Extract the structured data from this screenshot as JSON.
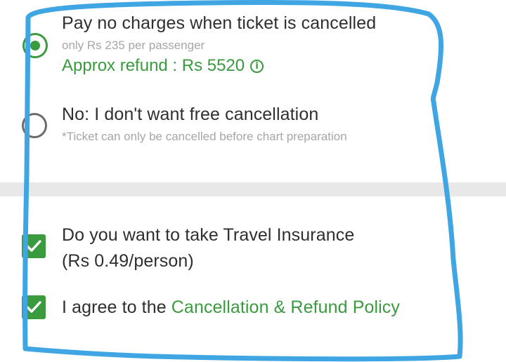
{
  "options": {
    "free_cancel": {
      "title": "Pay no charges when ticket is cancelled",
      "price_note": "only Rs 235 per passenger",
      "refund_text": "Approx refund : Rs 5520",
      "info_glyph": "i",
      "selected": true
    },
    "no_cancel": {
      "title": "No: I don't want free cancellation",
      "note": "*Ticket can only be cancelled before chart preparation",
      "selected": false
    }
  },
  "insurance": {
    "line1": "Do you want to take Travel Insurance",
    "line2": "(Rs 0.49/person)",
    "checked": true
  },
  "agreement": {
    "prefix": "I agree to the ",
    "link": "Cancellation & Refund Policy",
    "checked": true
  },
  "colors": {
    "accent_green": "#3a9a3e",
    "annotation_blue": "#3fa6e3",
    "divider_gray": "#e8e8e8"
  }
}
